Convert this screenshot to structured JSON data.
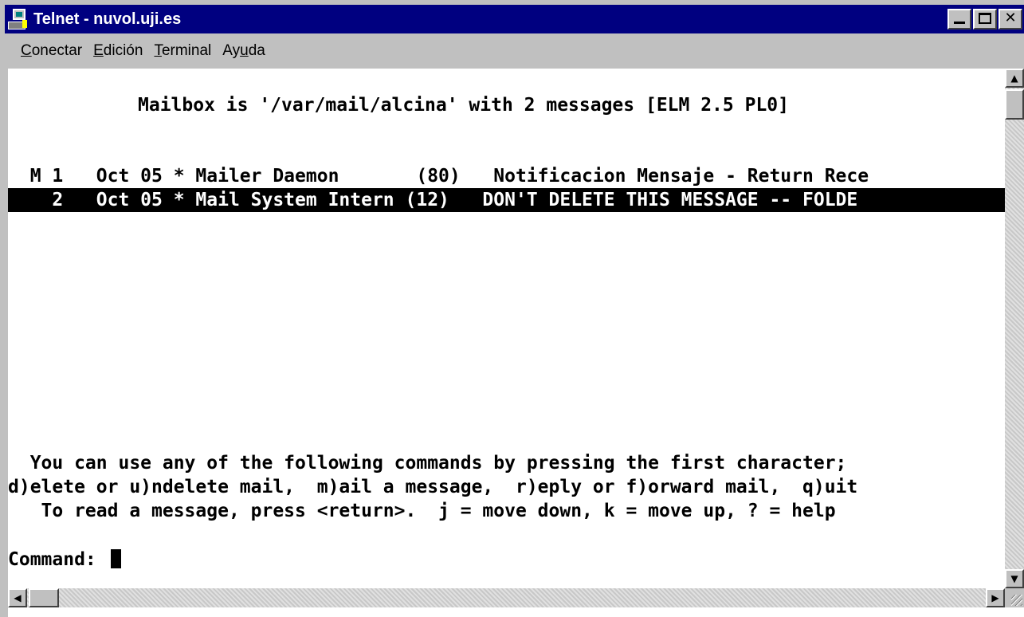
{
  "window": {
    "title": "Telnet - nuvol.uji.es",
    "controls": {
      "minimize": "minimize-icon",
      "maximize": "maximize-icon",
      "close": "✕"
    }
  },
  "menubar": {
    "items": [
      {
        "first": "C",
        "rest": "onectar"
      },
      {
        "first": "E",
        "rest": "dición"
      },
      {
        "first": "T",
        "rest": "erminal"
      },
      {
        "pre": "Ay",
        "first": "u",
        "rest": "da"
      }
    ]
  },
  "terminal": {
    "header": "Mailbox is '/var/mail/alcina' with 2 messages [ELM 2.5 PL0]",
    "messages": [
      {
        "line": "  M 1   Oct 05 * Mailer Daemon       (80)   Notificacion Mensaje - Return Rece",
        "selected": false
      },
      {
        "line": "    2   Oct 05 * Mail System Intern (12)   DON'T DELETE THIS MESSAGE -- FOLDE",
        "selected": true
      }
    ],
    "help_lines": [
      "  You can use any of the following commands by pressing the first character;",
      "d)elete or u)ndelete mail,  m)ail a message,  r)eply or f)orward mail,  q)uit",
      "   To read a message, press <return>.  j = move down, k = move up, ? = help"
    ],
    "prompt": "Command: "
  },
  "scrollbars": {
    "up_arrow": "▲",
    "down_arrow": "▼",
    "left_arrow": "◀",
    "right_arrow": "▶"
  }
}
